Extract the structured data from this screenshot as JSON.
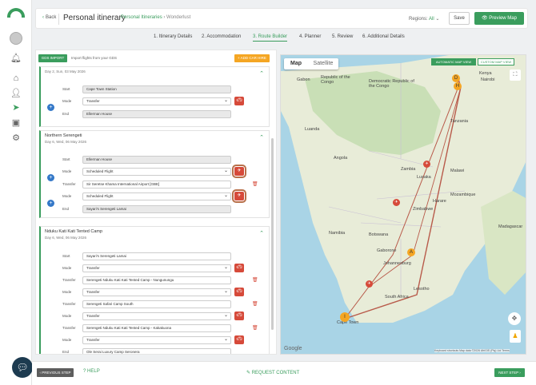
{
  "header": {
    "back": "Back",
    "title": "Personal itinerary",
    "crumb_parent": "Personal Itineraries",
    "crumb_sep": "›",
    "crumb_current": "Wonderlust",
    "regions_label": "Regions:",
    "regions_value": "All",
    "save": "Save",
    "preview": "Preview Map"
  },
  "tabs": [
    "1. Itinerary Details",
    "2. Accommodation",
    "3. Route Builder",
    "4. Planner",
    "5. Review",
    "6. Additional Details"
  ],
  "active_tab": "3. Route Builder",
  "panel": {
    "gds_import": "GDS IMPORT",
    "gds_note": "Import flights from your GDS",
    "add_car_hire": "+ ADD CAR HIRE"
  },
  "labels": {
    "start": "Start",
    "mode": "Mode",
    "end": "End",
    "transfer": "Transfer"
  },
  "card1": {
    "sub": "Day 2, Sun, 03 May 2026",
    "start": "Cape Town Station",
    "mode": "Transfer",
    "end": "Ellerman House"
  },
  "card2": {
    "title": "Northern Serengeti",
    "sub": "Day 6, Wed, 06 May 2026",
    "start": "Ellerman House",
    "mode1": "Scheduled Flight",
    "transfer": "Sir Seretse Khama International Airport [GBE]",
    "mode2": "Scheduled Flight",
    "end": "Sayari's Serengeti Lamai"
  },
  "card3": {
    "title": "Nduku Kati Kati Tented Camp",
    "sub": "Day 6, Wed, 06 May 2026",
    "start": "Sayari's Serengeti Lamai",
    "mode1": "Transfer",
    "transfer1": "Serengeti Nduku Kati Kati Tented Camp - Nungunungu",
    "mode2": "Transfer",
    "transfer2": "Serengeti Safari Camp South",
    "mode3": "Transfer",
    "transfer3": "Serengeti Nduku Kati Kati Tented Camp - Kakakuona",
    "mode4": "Transfer",
    "end": "Ole Serai Luxury Camp Seronera"
  },
  "map": {
    "tab_map": "Map",
    "tab_satellite": "Satellite",
    "auto_view": "AUTOMATIC MAP VIEW",
    "custom_view": "CUSTOM MAP VIEW",
    "google": "Google",
    "attribution": "Keyboard shortcuts    Map data ©2026 AfriGIS (Pty) Ltd    Terms",
    "labels": [
      "Kenya",
      "Gabon",
      "Republic of the Congo",
      "Democratic Republic of the Congo",
      "Tanzania",
      "Angola",
      "Zambia",
      "Malawi",
      "Mozambique",
      "Zimbabwe",
      "Namibia",
      "Botswana",
      "Gaborone",
      "Johannesburg",
      "South Africa",
      "Cape Town",
      "Nairobi",
      "Luanda",
      "Lusaka",
      "Harare",
      "Madagascar",
      "Lesotho"
    ],
    "markers": [
      "D",
      "H",
      "A",
      "I"
    ]
  },
  "footer": {
    "prev": "‹ PREVIOUS STEP",
    "help": "HELP",
    "request": "REQUEST CONTENT",
    "next": "NEXT STEP ›"
  },
  "colors": {
    "accent": "#3a9d5d",
    "route": "#b85a4a",
    "danger": "#d64a3a",
    "orange": "#f5a623"
  }
}
